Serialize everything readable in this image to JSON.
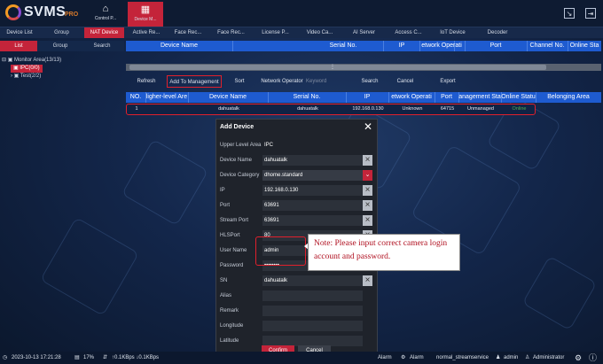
{
  "app": {
    "logo_text": "SVMS",
    "logo_suffix": "PRO"
  },
  "top_nav": {
    "home_label": "Control P...",
    "device_label": "Device M..."
  },
  "tabs": [
    {
      "label": "Device List"
    },
    {
      "label": "Group"
    },
    {
      "label": "NAT Device"
    },
    {
      "label": "Active Re..."
    },
    {
      "label": "Face Rec..."
    },
    {
      "label": "Face Rec..."
    },
    {
      "label": "License P..."
    },
    {
      "label": "Video Ca..."
    },
    {
      "label": "AI Server"
    },
    {
      "label": "Access C..."
    },
    {
      "label": "IoT Device"
    },
    {
      "label": "Decoder"
    }
  ],
  "subtabs": [
    {
      "label": "List"
    },
    {
      "label": "Group"
    },
    {
      "label": "Search"
    }
  ],
  "top_grid_headers": [
    "Device Name",
    "Serial No.",
    "IP",
    "etwork Operati",
    "Port",
    "Channel No.",
    "Online Sta"
  ],
  "tree": {
    "root": "Monitor Area(13/13)",
    "ipc": "IPC(0/0)",
    "test": "Test(2/2)"
  },
  "toolbar": {
    "refresh": "Refresh",
    "add_to_management": "Add To Management",
    "sort": "Sort",
    "network_operator": "Network Operator",
    "keyword_placeholder": "Keyword",
    "search": "Search",
    "cancel": "Cancel",
    "export": "Export"
  },
  "table": {
    "headers": [
      "NO.",
      "ligher-level Are",
      "Device Name",
      "Serial No.",
      "IP",
      "etwork Operati",
      "Port",
      "anagement Sta",
      "Online Statu",
      "Belonging Area"
    ],
    "rows": [
      [
        "1",
        "",
        "dahuatalk",
        "dahuatalk",
        "192.168.0.130",
        "Unknown",
        "64715",
        "Unmanaged",
        "Online",
        ""
      ]
    ],
    "online_color": "#4caf50"
  },
  "dialog": {
    "title": "Add Device",
    "fields": [
      {
        "label": "Upper Level Area",
        "value": "IPC"
      },
      {
        "label": "Device Name",
        "value": "dahuatalk"
      },
      {
        "label": "Device Category",
        "value": "dhome.standard"
      },
      {
        "label": "IP",
        "value": "192.168.0.130"
      },
      {
        "label": "Port",
        "value": "63691"
      },
      {
        "label": "Stream Port",
        "value": "63691"
      },
      {
        "label": "HLSPort",
        "value": "80"
      },
      {
        "label": "User Name",
        "value": "admin"
      },
      {
        "label": "Password",
        "value": "••••••••"
      },
      {
        "label": "SN",
        "value": "dahuatalk"
      },
      {
        "label": "Alias",
        "value": ""
      },
      {
        "label": "Remark",
        "value": ""
      },
      {
        "label": "Longitude",
        "value": ""
      },
      {
        "label": "Latitude",
        "value": ""
      }
    ],
    "confirm": "Confirm",
    "cancel": "Cancel"
  },
  "note": "Note: Please input correct camera login account and password.",
  "status_bar": {
    "datetime": "2023-10-13 17:21:28",
    "cpu": "17%",
    "network": "↑0.1KBps ↓0.1KBps",
    "alarm1": "Alarm",
    "alarm2": "Alarm",
    "stream_service": "normal_streamservice",
    "user": "admin",
    "role": "Administrator"
  },
  "colors": {
    "accent_red": "#c4243a",
    "header_blue": "#1e5bd0",
    "note_text": "#b01020"
  }
}
